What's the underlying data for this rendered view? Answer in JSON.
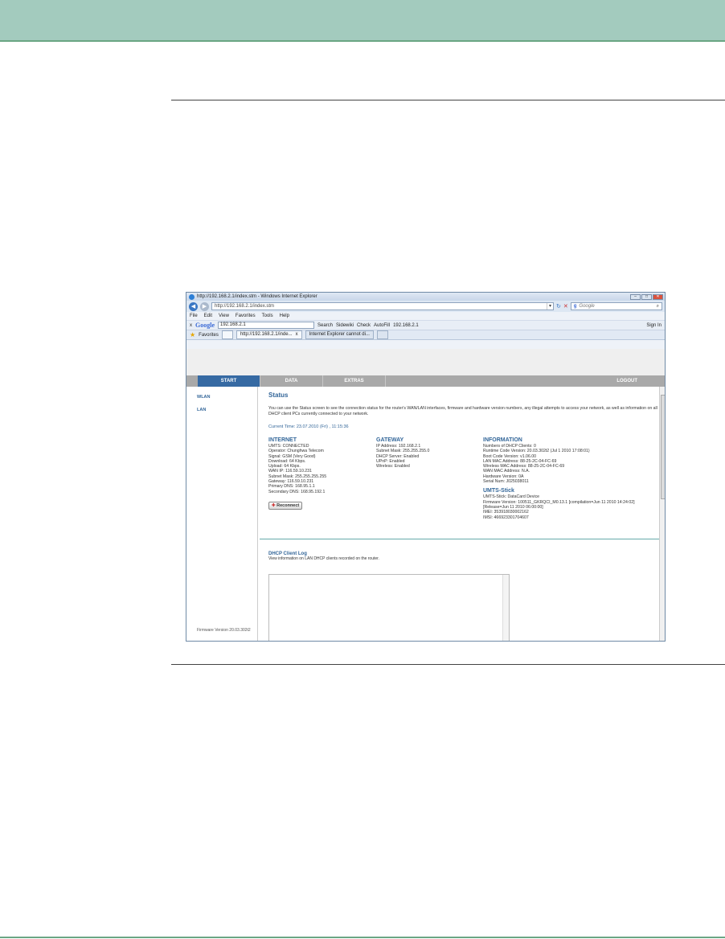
{
  "browser": {
    "title": "http://192.168.2.1/index.stm - Windows Internet Explorer",
    "address": "http://192.168.2.1/index.stm",
    "search_placeholder": "Google",
    "menu": [
      "File",
      "Edit",
      "View",
      "Favorites",
      "Tools",
      "Help"
    ],
    "google_bar": {
      "logo": "Google",
      "query": "192.168.2.1",
      "search": "Search",
      "sidewiki": "Sidewiki",
      "check": "Check",
      "autofill": "AutoFill",
      "link": "192.168.2.1",
      "signin": "Sign In"
    },
    "favorites_label": "Favorites",
    "tabs": [
      "http://192.168.2.1/inde...",
      "Internet Explorer cannot di..."
    ]
  },
  "router": {
    "nav": [
      "START",
      "DATA",
      "EXTRAS"
    ],
    "logout": "LOGOUT",
    "side": [
      "WLAN",
      "LAN"
    ],
    "firmware_footer": "Firmware Version 20.03.302t2",
    "heading": "Status",
    "intro": "You can use the Status screen to see the connection status for the router's WAN/LAN interfaces, firmware and hardware version numbers, any illegal attempts to access your network, as well as information on all DHCP client PCs currently connected to your network.",
    "current_time": "Current Time: 23.07.2010 (Fri) , 11:15:36",
    "internet": {
      "title": "INTERNET",
      "lines": [
        "UMTS:  CONNECTED",
        "Operator:  Chunghwa Telecom",
        "Signal:  GSM (Very Good)",
        "Download:  64 Kbps.",
        "Upload:  64 Kbps.",
        "WAN IP:  116.59.10.231",
        "Subnet Mask:  255.255.255.255",
        "Gateway:  116.59.10.231",
        "Primary DNS:  168.95.1.1",
        "Secondary DNS:  168.95.192.1"
      ]
    },
    "gateway": {
      "title": "GATEWAY",
      "lines": [
        "IP Address:  192.168.2.1",
        "Subnet Mask:  255.255.255.0",
        "DHCP Server:  Enabled",
        "UPnP:  Enabled",
        "Wireless:  Enabled"
      ]
    },
    "information": {
      "title": "INFORMATION",
      "lines": [
        "Numbers of DHCP Clients:  0",
        "Runtime Code Version:  20.03.302t2 (Jul 1 2010 17:08:01)",
        "Boot Code Version:  v1.06.00",
        "LAN MAC Address: 88-25-2C-04-FC-69",
        "Wireless MAC Address: 88-25-2C-04-FC-69",
        "WAN MAC Address: N.A.",
        "Hardware Version:  0A",
        "Serial Num:  J025038011"
      ]
    },
    "umts": {
      "title": "UMTS-Stick",
      "lines": [
        "UMTS-Stick: DataCard Device",
        "Firmware Version: 100511_GKRQCI_M0.13.1 [compilation=Jun 11 2010 14:24:02][Release=Jun 11 2010 06:00:00]",
        "IMEI: 353918030002162",
        "IMSI: 466923301704607"
      ]
    },
    "reconnect": "Reconnect",
    "dhcp_title": "DHCP Client Log",
    "dhcp_desc": "View information on LAN DHCP clients recorded on the router."
  }
}
